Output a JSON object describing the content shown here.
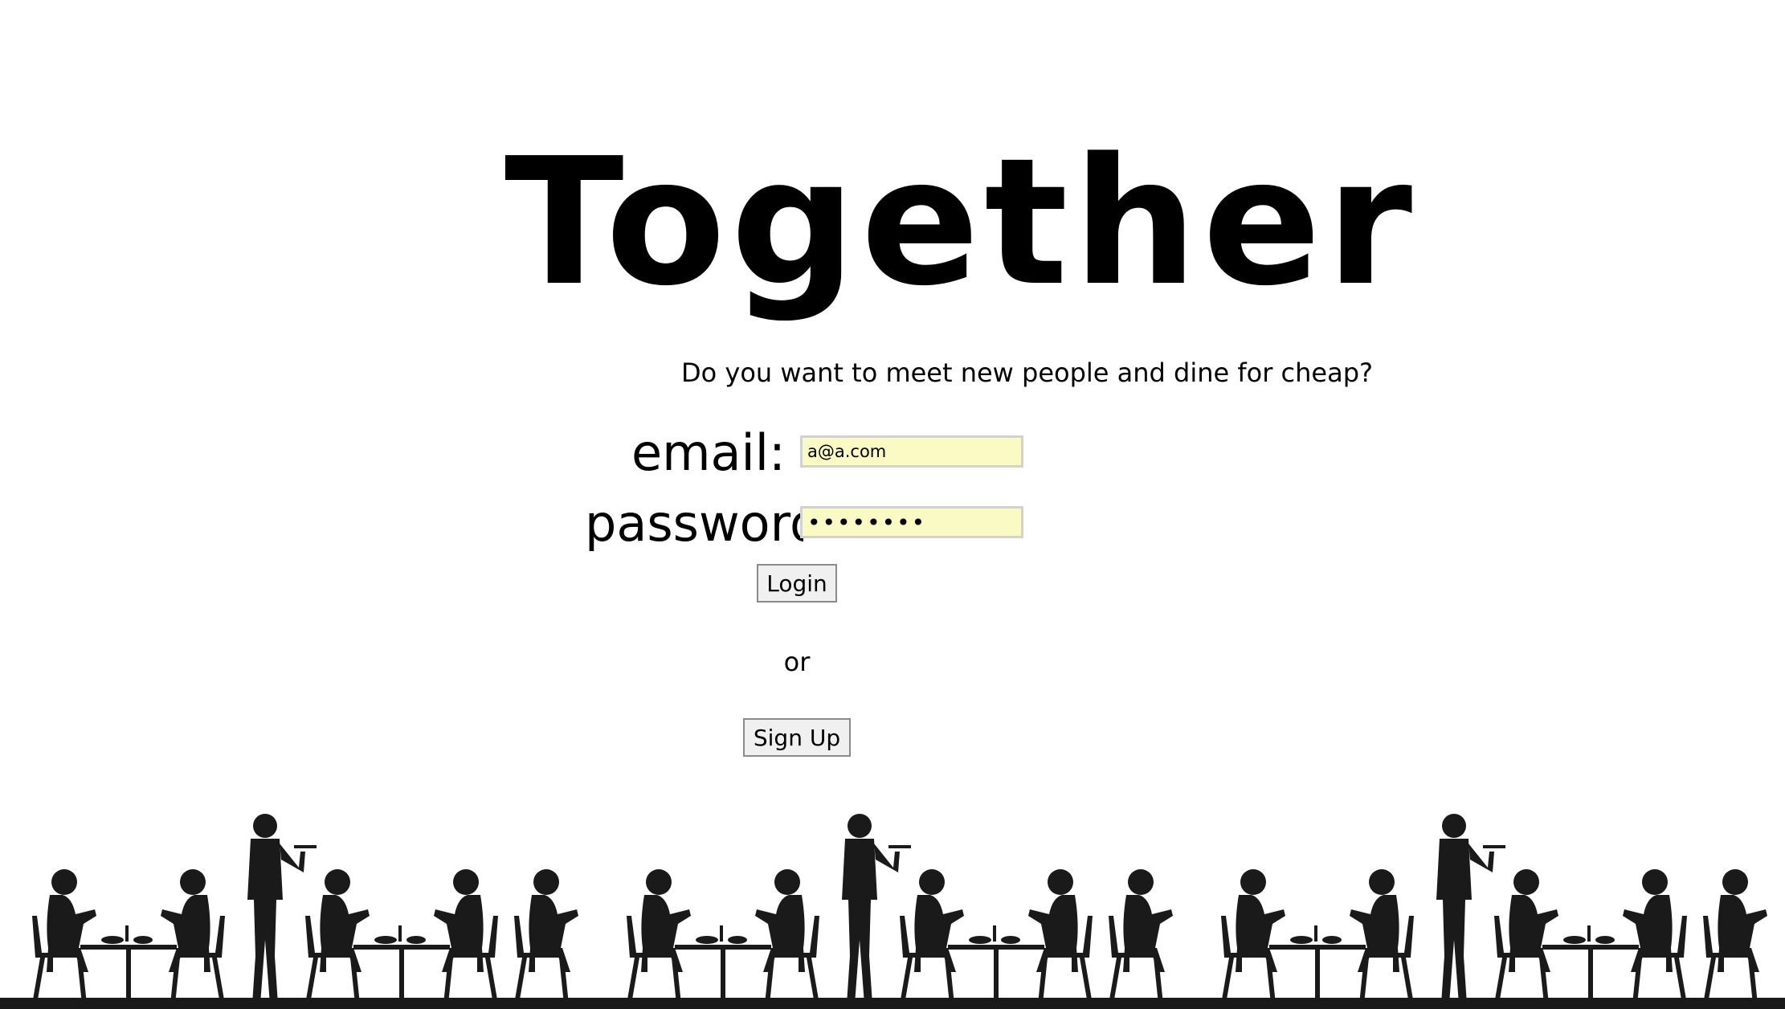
{
  "app": {
    "title": "Together",
    "tagline": "Do you want to meet new people and dine for cheap?"
  },
  "form": {
    "email_label": "email:",
    "email_value": "a@a.com",
    "password_label": "password:",
    "password_value": "••••••••",
    "login_label": "Login",
    "or_text": "or",
    "signup_label": "Sign Up"
  },
  "banner": {
    "icon": "dining-people-silhouette",
    "color": "#1a1a1a"
  },
  "colors": {
    "field_autofill_bg": "#fafbc4",
    "field_border": "#d2d2d2",
    "button_bg": "#f0f0f0"
  }
}
